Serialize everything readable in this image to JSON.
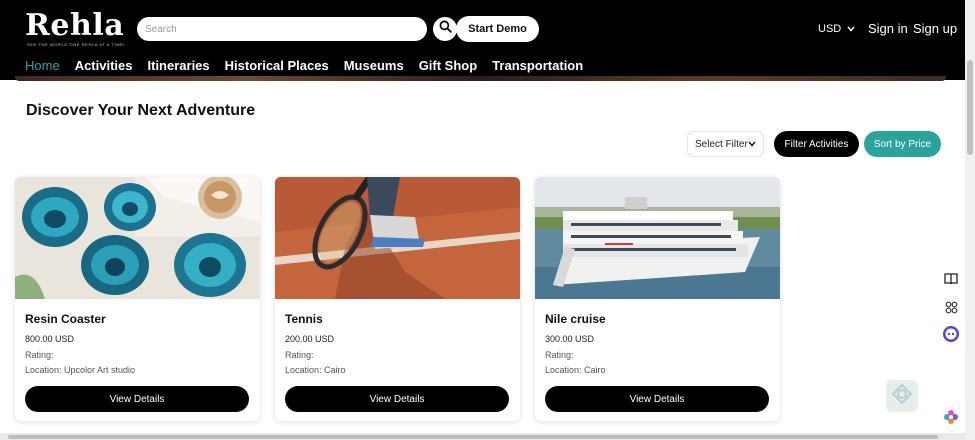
{
  "brand": {
    "name": "Rehla",
    "tagline": "SEE THE WORLD ONE REHLA AT A TIME!"
  },
  "header": {
    "search_placeholder": "Search",
    "start_demo_label": "Start Demo",
    "currency": "USD",
    "sign_in_label": "Sign in",
    "sign_up_label": "Sign up"
  },
  "nav": {
    "items": [
      {
        "label": "Home"
      },
      {
        "label": "Activities"
      },
      {
        "label": "Itineraries"
      },
      {
        "label": "Historical Places"
      },
      {
        "label": "Museums"
      },
      {
        "label": "Gift Shop"
      },
      {
        "label": "Transportation"
      }
    ],
    "active": "Home"
  },
  "main": {
    "title": "Discover Your Next Adventure",
    "filter_select_value": "Select Filter",
    "filter_button_label": "Filter Activities",
    "sort_button_label": "Sort by Price"
  },
  "cards": [
    {
      "name": "Resin Coaster",
      "price": "800.00 USD",
      "rating": "Rating:",
      "location": "Location: Upcolor Art studio",
      "button_label": "View Details",
      "image": "resin-coaster-photo"
    },
    {
      "name": "Tennis",
      "price": "200.00 USD",
      "rating": "Rating:",
      "location": "Location: Cairo",
      "button_label": "View Details",
      "image": "tennis-photo"
    },
    {
      "name": "Nile cruise",
      "price": "300.00 USD",
      "rating": "Rating:",
      "location": "Location: Cairo",
      "button_label": "View Details",
      "image": "nile-cruise-photo"
    }
  ],
  "colors": {
    "header_bg": "#000000",
    "accent": "#2aa39b",
    "button_dark": "#000000"
  },
  "icons": {
    "search": "search-icon",
    "currency_dropdown": "chevron-down-icon",
    "select_dropdown": "chevron-down-icon",
    "side_tools": [
      "book-icon",
      "grid-icon",
      "assistant-icon",
      "flower-icon"
    ]
  }
}
